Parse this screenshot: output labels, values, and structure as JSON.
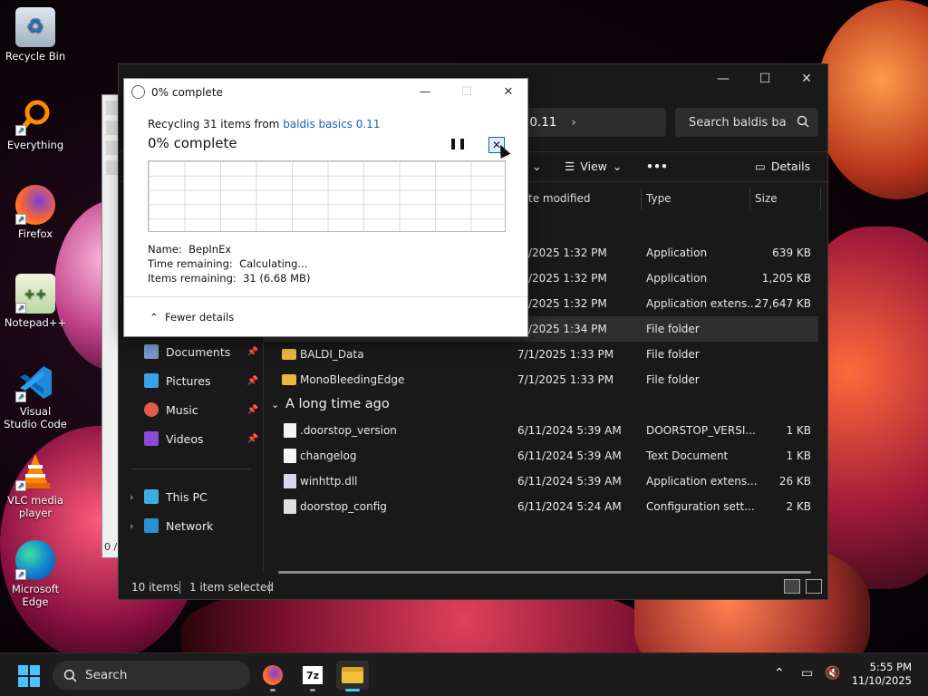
{
  "desktop": {
    "icons": [
      {
        "label": "Recycle Bin",
        "icon": "recycle-bin-icon"
      },
      {
        "label": "Everything",
        "icon": "everything-icon"
      },
      {
        "label": "Firefox",
        "icon": "firefox-icon"
      },
      {
        "label": "Notepad++",
        "icon": "notepad-plus-plus-icon"
      },
      {
        "label": "Visual Studio Code",
        "icon": "vscode-icon"
      },
      {
        "label": "VLC media player",
        "icon": "vlc-icon"
      },
      {
        "label": "Microsoft Edge",
        "icon": "edge-icon"
      }
    ]
  },
  "explorer": {
    "address_tail": "s 0.11",
    "search_placeholder": "Search baldis ba",
    "toolbar": {
      "view_label": "View",
      "details_label": "Details",
      "more": "•••"
    },
    "columns": {
      "date_modified": "te modified",
      "type": "Type",
      "size": "Size"
    },
    "nav": [
      {
        "label": "Documents",
        "pinned": true
      },
      {
        "label": "Pictures",
        "pinned": true
      },
      {
        "label": "Music",
        "pinned": true
      },
      {
        "label": "Videos",
        "pinned": true
      },
      {
        "label": "This PC",
        "pinned": false
      },
      {
        "label": "Network",
        "pinned": false
      }
    ],
    "files_recent": [
      {
        "name": "",
        "date": "/2025 1:32 PM",
        "type": "Application",
        "size": "639 KB",
        "kind": "app"
      },
      {
        "name": "",
        "date": "/2025 1:32 PM",
        "type": "Application",
        "size": "1,205 KB",
        "kind": "app"
      },
      {
        "name": "",
        "date": "/2025 1:32 PM",
        "type": "Application extens...",
        "size": "27,647 KB",
        "kind": "dll"
      },
      {
        "name": "",
        "date": "/2025 1:34 PM",
        "type": "File folder",
        "size": "",
        "kind": "folder",
        "selected": true
      },
      {
        "name": "BALDI_Data",
        "date": "7/1/2025 1:33 PM",
        "type": "File folder",
        "size": "",
        "kind": "folder"
      },
      {
        "name": "MonoBleedingEdge",
        "date": "7/1/2025 1:33 PM",
        "type": "File folder",
        "size": "",
        "kind": "folder"
      }
    ],
    "group_old": "A long time ago",
    "files_old": [
      {
        "name": ".doorstop_version",
        "date": "6/11/2024 5:39 AM",
        "type": "DOORSTOP_VERSI...",
        "size": "1 KB"
      },
      {
        "name": "changelog",
        "date": "6/11/2024 5:39 AM",
        "type": "Text Document",
        "size": "1 KB"
      },
      {
        "name": "winhttp.dll",
        "date": "6/11/2024 5:39 AM",
        "type": "Application extens...",
        "size": "26 KB"
      },
      {
        "name": "doorstop_config",
        "date": "6/11/2024 5:24 AM",
        "type": "Configuration sett...",
        "size": "2 KB"
      }
    ],
    "status": {
      "count": "10 items",
      "selected": "1 item selected"
    }
  },
  "dialog": {
    "title": "0% complete",
    "line_prefix": "Recycling 31 items from ",
    "line_link": "baldis basics 0.11",
    "big": "0% complete",
    "name_label": "Name:",
    "name_value": "BepInEx",
    "time_label": "Time remaining:",
    "time_value": "Calculating...",
    "items_label": "Items remaining:",
    "items_value": "31 (6.68 MB)",
    "fewer_details": "Fewer details"
  },
  "bg7zip": {
    "status_fragment": "0 /"
  },
  "taskbar": {
    "search_label": "Search",
    "time": "5:55 PM",
    "date": "11/10/2025"
  }
}
